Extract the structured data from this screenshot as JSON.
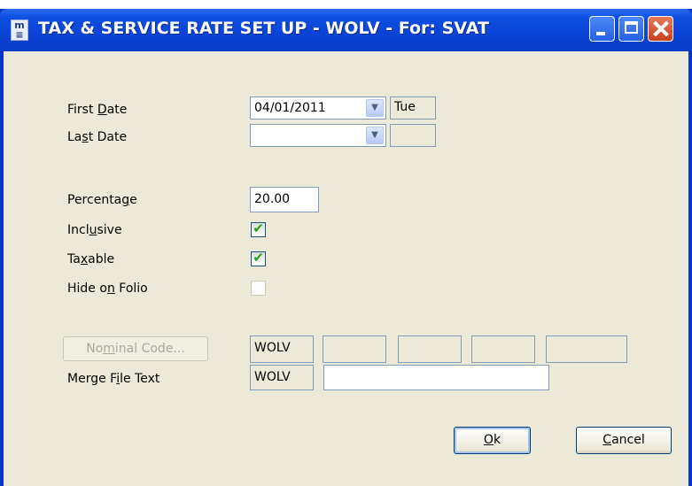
{
  "window": {
    "title": "TAX & SERVICE RATE SET UP - WOLV - For: SVAT"
  },
  "form": {
    "first_date": {
      "label_pre": "First ",
      "label_key": "D",
      "label_post": "ate",
      "value": "04/01/2011",
      "day": "Tue"
    },
    "last_date": {
      "label_pre": "La",
      "label_key": "s",
      "label_post": "t Date",
      "value": "",
      "day": ""
    },
    "percentage": {
      "label_pre": "Percenta",
      "label_key": "g",
      "label_post": "e",
      "value": "20.00"
    },
    "inclusive": {
      "label_pre": "Incl",
      "label_key": "u",
      "label_post": "sive",
      "checked": true
    },
    "taxable": {
      "label_pre": "Ta",
      "label_key": "x",
      "label_post": "able",
      "checked": true
    },
    "hide_on_folio": {
      "label_pre": "Hide o",
      "label_key": "n",
      "label_post": " Folio",
      "checked": false
    },
    "nominal_code": {
      "button_pre": "No",
      "button_key": "m",
      "button_post": "inal Code...",
      "code": "WOLV",
      "parts": [
        "",
        "",
        "",
        ""
      ]
    },
    "merge_file_text": {
      "label_pre": "Merge F",
      "label_key": "i",
      "label_post": "le Text",
      "code": "WOLV",
      "value": ""
    }
  },
  "buttons": {
    "ok": {
      "key": "O",
      "rest": "k"
    },
    "cancel": {
      "key": "C",
      "rest": "ancel"
    }
  },
  "colors": {
    "accent": "#0a43d6",
    "client_bg": "#ece9d8",
    "check": "#21a121"
  }
}
